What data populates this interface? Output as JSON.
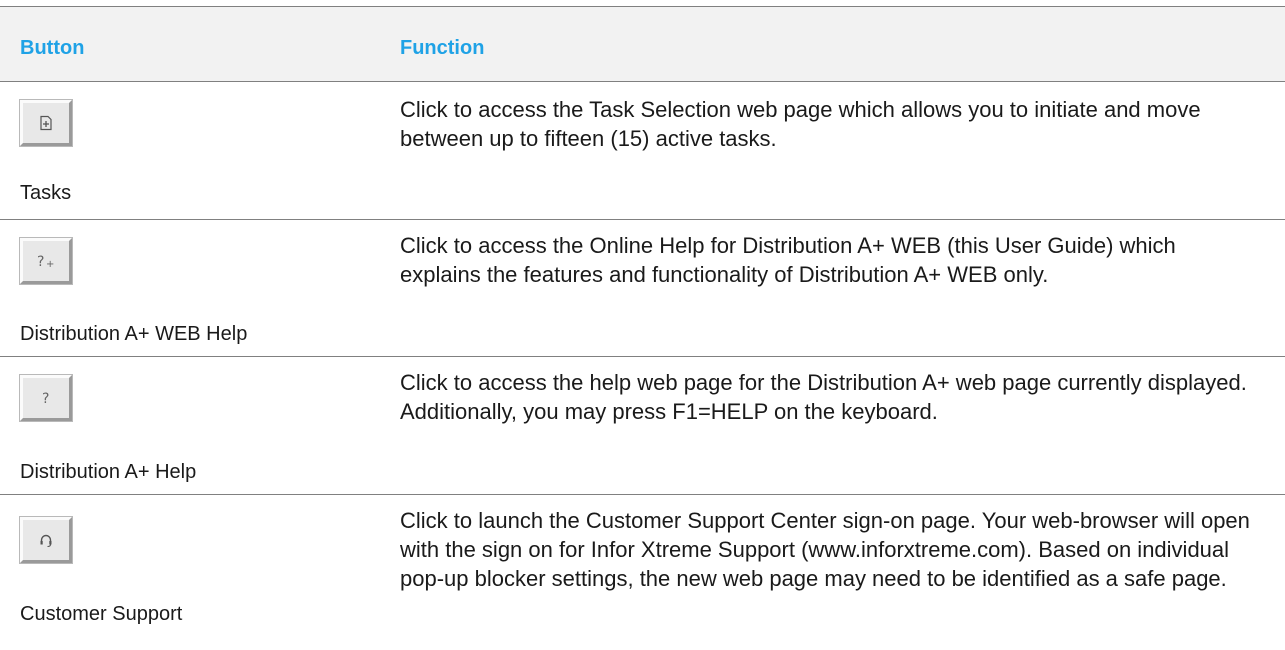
{
  "header": {
    "button_label": "Button",
    "function_label": "Function"
  },
  "colors": {
    "header_text": "#1fa2e6",
    "header_background": "#f2f2f2",
    "rule": "#808080"
  },
  "rows": [
    {
      "icon": "task-add-icon",
      "caption": "Tasks",
      "function": "Click to access the Task Selection web page which allows you to initiate and move between up to fifteen (15) active tasks."
    },
    {
      "icon": "web-help-icon",
      "caption": "Distribution A+ WEB Help",
      "function": "Click to access the Online Help for Distribution A+ WEB (this User Guide) which explains the features and functionality of Distribution A+ WEB only."
    },
    {
      "icon": "help-icon",
      "caption": "Distribution A+ Help",
      "function": "Click to access the help web page for the Distribution A+ web page currently displayed. Additionally, you may press F1=HELP on the keyboard."
    },
    {
      "icon": "headset-icon",
      "caption": "Customer Support",
      "function": "Click to launch the Customer Support Center sign-on page. Your web-browser will open with the sign on for Infor Xtreme Support (www.inforxtreme.com). Based on individual pop-up blocker settings, the new web page may need to be identified as a safe page."
    }
  ]
}
